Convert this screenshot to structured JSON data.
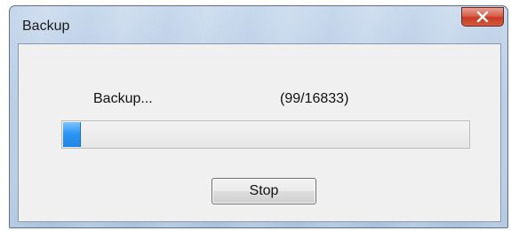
{
  "window": {
    "title": "Backup",
    "close_icon": "close-icon"
  },
  "status": {
    "label": "Backup...",
    "count": "(99/16833)"
  },
  "progress": {
    "current": 99,
    "total": 16833,
    "accent_color": "#2f95f2"
  },
  "actions": {
    "stop_label": "Stop"
  }
}
